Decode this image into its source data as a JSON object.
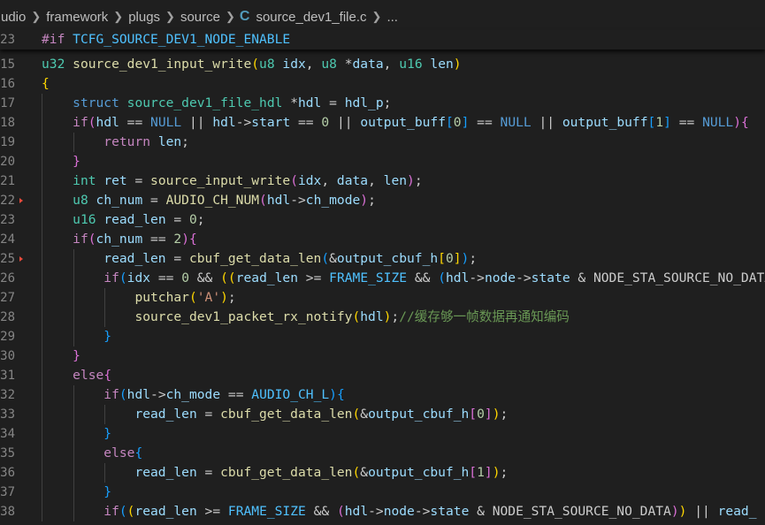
{
  "breadcrumb": {
    "items": [
      "udio",
      "framework",
      "plugs",
      "source"
    ],
    "file_icon": "C",
    "file_name": "source_dev1_file.c",
    "ellipsis": "..."
  },
  "editor": {
    "sticky_line": {
      "number": "23",
      "segments": [
        [
          "pp",
          "#if"
        ],
        [
          "p",
          " "
        ],
        [
          "m",
          "TCFG_SOURCE_DEV1_NODE_ENABLE"
        ]
      ]
    },
    "lines": [
      {
        "number": "15",
        "marker": false,
        "segments": [
          [
            "t",
            "u32"
          ],
          [
            "p",
            " "
          ],
          [
            "f",
            "source_dev1_input_write"
          ],
          [
            "b1",
            "("
          ],
          [
            "t",
            "u8"
          ],
          [
            "p",
            " "
          ],
          [
            "v",
            "idx"
          ],
          [
            "p",
            ", "
          ],
          [
            "t",
            "u8"
          ],
          [
            "p",
            " *"
          ],
          [
            "v",
            "data"
          ],
          [
            "p",
            ", "
          ],
          [
            "t",
            "u16"
          ],
          [
            "p",
            " "
          ],
          [
            "v",
            "len"
          ],
          [
            "b1",
            ")"
          ]
        ]
      },
      {
        "number": "16",
        "marker": false,
        "segments": [
          [
            "b1",
            "{"
          ]
        ]
      },
      {
        "number": "17",
        "marker": false,
        "segments": [
          [
            "p",
            "    "
          ],
          [
            "k",
            "struct"
          ],
          [
            "p",
            " "
          ],
          [
            "t",
            "source_dev1_file_hdl"
          ],
          [
            "p",
            " *"
          ],
          [
            "v",
            "hdl"
          ],
          [
            "p",
            " = "
          ],
          [
            "v",
            "hdl_p"
          ],
          [
            "p",
            ";"
          ]
        ]
      },
      {
        "number": "18",
        "marker": false,
        "segments": [
          [
            "p",
            "    "
          ],
          [
            "c",
            "if"
          ],
          [
            "b2",
            "("
          ],
          [
            "v",
            "hdl"
          ],
          [
            "p",
            " == "
          ],
          [
            "k",
            "NULL"
          ],
          [
            "p",
            " || "
          ],
          [
            "v",
            "hdl"
          ],
          [
            "p",
            "->"
          ],
          [
            "v",
            "start"
          ],
          [
            "p",
            " == "
          ],
          [
            "n",
            "0"
          ],
          [
            "p",
            " || "
          ],
          [
            "v",
            "output_buff"
          ],
          [
            "b3",
            "["
          ],
          [
            "n",
            "0"
          ],
          [
            "b3",
            "]"
          ],
          [
            "p",
            " == "
          ],
          [
            "k",
            "NULL"
          ],
          [
            "p",
            " || "
          ],
          [
            "v",
            "output_buff"
          ],
          [
            "b3",
            "["
          ],
          [
            "n",
            "1"
          ],
          [
            "b3",
            "]"
          ],
          [
            "p",
            " == "
          ],
          [
            "k",
            "NULL"
          ],
          [
            "b2",
            ")"
          ],
          [
            "b2",
            "{"
          ]
        ]
      },
      {
        "number": "19",
        "marker": false,
        "segments": [
          [
            "p",
            "        "
          ],
          [
            "c",
            "return"
          ],
          [
            "p",
            " "
          ],
          [
            "v",
            "len"
          ],
          [
            "p",
            ";"
          ]
        ]
      },
      {
        "number": "20",
        "marker": false,
        "segments": [
          [
            "p",
            "    "
          ],
          [
            "b2",
            "}"
          ]
        ]
      },
      {
        "number": "21",
        "marker": false,
        "segments": [
          [
            "p",
            "    "
          ],
          [
            "t",
            "int"
          ],
          [
            "p",
            " "
          ],
          [
            "v",
            "ret"
          ],
          [
            "p",
            " = "
          ],
          [
            "f",
            "source_input_write"
          ],
          [
            "b2",
            "("
          ],
          [
            "v",
            "idx"
          ],
          [
            "p",
            ", "
          ],
          [
            "v",
            "data"
          ],
          [
            "p",
            ", "
          ],
          [
            "v",
            "len"
          ],
          [
            "b2",
            ")"
          ],
          [
            "p",
            ";"
          ]
        ]
      },
      {
        "number": "22",
        "marker": true,
        "segments": [
          [
            "p",
            "    "
          ],
          [
            "t",
            "u8"
          ],
          [
            "p",
            " "
          ],
          [
            "v",
            "ch_num"
          ],
          [
            "p",
            " = "
          ],
          [
            "f",
            "AUDIO_CH_NUM"
          ],
          [
            "b2",
            "("
          ],
          [
            "v",
            "hdl"
          ],
          [
            "p",
            "->"
          ],
          [
            "v",
            "ch_mode"
          ],
          [
            "b2",
            ")"
          ],
          [
            "p",
            ";"
          ]
        ]
      },
      {
        "number": "23",
        "marker": false,
        "segments": [
          [
            "p",
            "    "
          ],
          [
            "t",
            "u16"
          ],
          [
            "p",
            " "
          ],
          [
            "v",
            "read_len"
          ],
          [
            "p",
            " = "
          ],
          [
            "n",
            "0"
          ],
          [
            "p",
            ";"
          ]
        ]
      },
      {
        "number": "24",
        "marker": false,
        "segments": [
          [
            "p",
            "    "
          ],
          [
            "c",
            "if"
          ],
          [
            "b2",
            "("
          ],
          [
            "v",
            "ch_num"
          ],
          [
            "p",
            " == "
          ],
          [
            "n",
            "2"
          ],
          [
            "b2",
            ")"
          ],
          [
            "b2",
            "{"
          ]
        ]
      },
      {
        "number": "25",
        "marker": true,
        "segments": [
          [
            "p",
            "        "
          ],
          [
            "v",
            "read_len"
          ],
          [
            "p",
            " = "
          ],
          [
            "f",
            "cbuf_get_data_len"
          ],
          [
            "b3",
            "("
          ],
          [
            "p",
            "&"
          ],
          [
            "v",
            "output_cbuf_h"
          ],
          [
            "b1",
            "["
          ],
          [
            "n",
            "0"
          ],
          [
            "b1",
            "]"
          ],
          [
            "b3",
            ")"
          ],
          [
            "p",
            ";"
          ]
        ]
      },
      {
        "number": "26",
        "marker": false,
        "segments": [
          [
            "p",
            "        "
          ],
          [
            "c",
            "if"
          ],
          [
            "b3",
            "("
          ],
          [
            "v",
            "idx"
          ],
          [
            "p",
            " == "
          ],
          [
            "n",
            "0"
          ],
          [
            "p",
            " && "
          ],
          [
            "b1",
            "(("
          ],
          [
            "v",
            "read_len"
          ],
          [
            "p",
            " >= "
          ],
          [
            "m",
            "FRAME_SIZE"
          ],
          [
            "p",
            " && "
          ],
          [
            "b3",
            "("
          ],
          [
            "v",
            "hdl"
          ],
          [
            "p",
            "->"
          ],
          [
            "v",
            "node"
          ],
          [
            "p",
            "->"
          ],
          [
            "v",
            "state"
          ],
          [
            "p",
            " & "
          ],
          [
            "p",
            "NODE_STA_SOURCE_NO_DATA"
          ]
        ]
      },
      {
        "number": "27",
        "marker": false,
        "segments": [
          [
            "p",
            "            "
          ],
          [
            "f",
            "putchar"
          ],
          [
            "b1",
            "("
          ],
          [
            "s",
            "'A'"
          ],
          [
            "b1",
            ")"
          ],
          [
            "p",
            ";"
          ]
        ]
      },
      {
        "number": "28",
        "marker": false,
        "segments": [
          [
            "p",
            "            "
          ],
          [
            "f",
            "source_dev1_packet_rx_notify"
          ],
          [
            "b1",
            "("
          ],
          [
            "v",
            "hdl"
          ],
          [
            "b1",
            ")"
          ],
          [
            "p",
            ";"
          ],
          [
            "cm",
            "//缓存够一帧数据再通知编码"
          ]
        ]
      },
      {
        "number": "29",
        "marker": false,
        "segments": [
          [
            "p",
            "        "
          ],
          [
            "b3",
            "}"
          ]
        ]
      },
      {
        "number": "30",
        "marker": false,
        "segments": [
          [
            "p",
            "    "
          ],
          [
            "b2",
            "}"
          ]
        ]
      },
      {
        "number": "31",
        "marker": false,
        "segments": [
          [
            "p",
            "    "
          ],
          [
            "c",
            "else"
          ],
          [
            "b2",
            "{"
          ]
        ]
      },
      {
        "number": "32",
        "marker": false,
        "segments": [
          [
            "p",
            "        "
          ],
          [
            "c",
            "if"
          ],
          [
            "b3",
            "("
          ],
          [
            "v",
            "hdl"
          ],
          [
            "p",
            "->"
          ],
          [
            "v",
            "ch_mode"
          ],
          [
            "p",
            " == "
          ],
          [
            "m",
            "AUDIO_CH_L"
          ],
          [
            "b3",
            ")"
          ],
          [
            "b3",
            "{"
          ]
        ]
      },
      {
        "number": "33",
        "marker": false,
        "segments": [
          [
            "p",
            "            "
          ],
          [
            "v",
            "read_len"
          ],
          [
            "p",
            " = "
          ],
          [
            "f",
            "cbuf_get_data_len"
          ],
          [
            "b1",
            "("
          ],
          [
            "p",
            "&"
          ],
          [
            "v",
            "output_cbuf_h"
          ],
          [
            "b2",
            "["
          ],
          [
            "n",
            "0"
          ],
          [
            "b2",
            "]"
          ],
          [
            "b1",
            ")"
          ],
          [
            "p",
            ";"
          ]
        ]
      },
      {
        "number": "34",
        "marker": false,
        "segments": [
          [
            "p",
            "        "
          ],
          [
            "b3",
            "}"
          ]
        ]
      },
      {
        "number": "35",
        "marker": false,
        "segments": [
          [
            "p",
            "        "
          ],
          [
            "c",
            "else"
          ],
          [
            "b3",
            "{"
          ]
        ]
      },
      {
        "number": "36",
        "marker": false,
        "segments": [
          [
            "p",
            "            "
          ],
          [
            "v",
            "read_len"
          ],
          [
            "p",
            " = "
          ],
          [
            "f",
            "cbuf_get_data_len"
          ],
          [
            "b1",
            "("
          ],
          [
            "p",
            "&"
          ],
          [
            "v",
            "output_cbuf_h"
          ],
          [
            "b2",
            "["
          ],
          [
            "n",
            "1"
          ],
          [
            "b2",
            "]"
          ],
          [
            "b1",
            ")"
          ],
          [
            "p",
            ";"
          ]
        ]
      },
      {
        "number": "37",
        "marker": false,
        "segments": [
          [
            "p",
            "        "
          ],
          [
            "b3",
            "}"
          ]
        ]
      },
      {
        "number": "38",
        "marker": false,
        "segments": [
          [
            "p",
            "        "
          ],
          [
            "c",
            "if"
          ],
          [
            "b3",
            "("
          ],
          [
            "b1",
            "("
          ],
          [
            "v",
            "read_len"
          ],
          [
            "p",
            " >= "
          ],
          [
            "m",
            "FRAME_SIZE"
          ],
          [
            "p",
            " && "
          ],
          [
            "b2",
            "("
          ],
          [
            "v",
            "hdl"
          ],
          [
            "p",
            "->"
          ],
          [
            "v",
            "node"
          ],
          [
            "p",
            "->"
          ],
          [
            "v",
            "state"
          ],
          [
            "p",
            " & "
          ],
          [
            "p",
            "NODE_STA_SOURCE_NO_DATA"
          ],
          [
            "b2",
            ")"
          ],
          [
            "b1",
            ")"
          ],
          [
            "p",
            " || "
          ],
          [
            "v",
            "read_"
          ]
        ]
      }
    ]
  }
}
